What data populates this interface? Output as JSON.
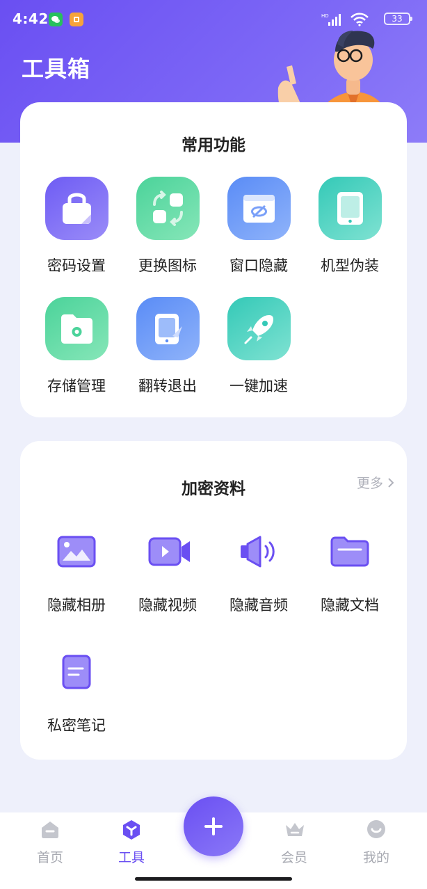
{
  "status_bar": {
    "time": "4:42",
    "network": "HD",
    "battery": "33"
  },
  "header": {
    "title": "工具箱"
  },
  "common_section": {
    "title": "常用功能",
    "items": [
      {
        "label": "密码设置",
        "icon": "lock-icon"
      },
      {
        "label": "更换图标",
        "icon": "swap-icon"
      },
      {
        "label": "窗口隐藏",
        "icon": "window-hide-icon"
      },
      {
        "label": "机型伪装",
        "icon": "tablet-icon"
      },
      {
        "label": "存储管理",
        "icon": "folder-gear-icon"
      },
      {
        "label": "翻转退出",
        "icon": "flip-exit-icon"
      },
      {
        "label": "一键加速",
        "icon": "rocket-icon"
      }
    ]
  },
  "encrypted_section": {
    "title": "加密资料",
    "more_label": "更多",
    "items": [
      {
        "label": "隐藏相册",
        "icon": "photo-icon"
      },
      {
        "label": "隐藏视频",
        "icon": "video-icon"
      },
      {
        "label": "隐藏音频",
        "icon": "speaker-icon"
      },
      {
        "label": "隐藏文档",
        "icon": "folder-icon"
      },
      {
        "label": "私密笔记",
        "icon": "note-icon"
      }
    ]
  },
  "tabbar": {
    "items": [
      {
        "label": "首页",
        "icon": "home-icon",
        "active": false
      },
      {
        "label": "工具",
        "icon": "tools-icon",
        "active": true
      },
      {
        "label": "会员",
        "icon": "crown-icon",
        "active": false
      },
      {
        "label": "我的",
        "icon": "profile-icon",
        "active": false
      }
    ],
    "fab_icon": "plus-icon"
  },
  "colors": {
    "primary": "#6a4ff2",
    "background": "#eef0fb",
    "inactive_tab": "#a7a9b1"
  }
}
